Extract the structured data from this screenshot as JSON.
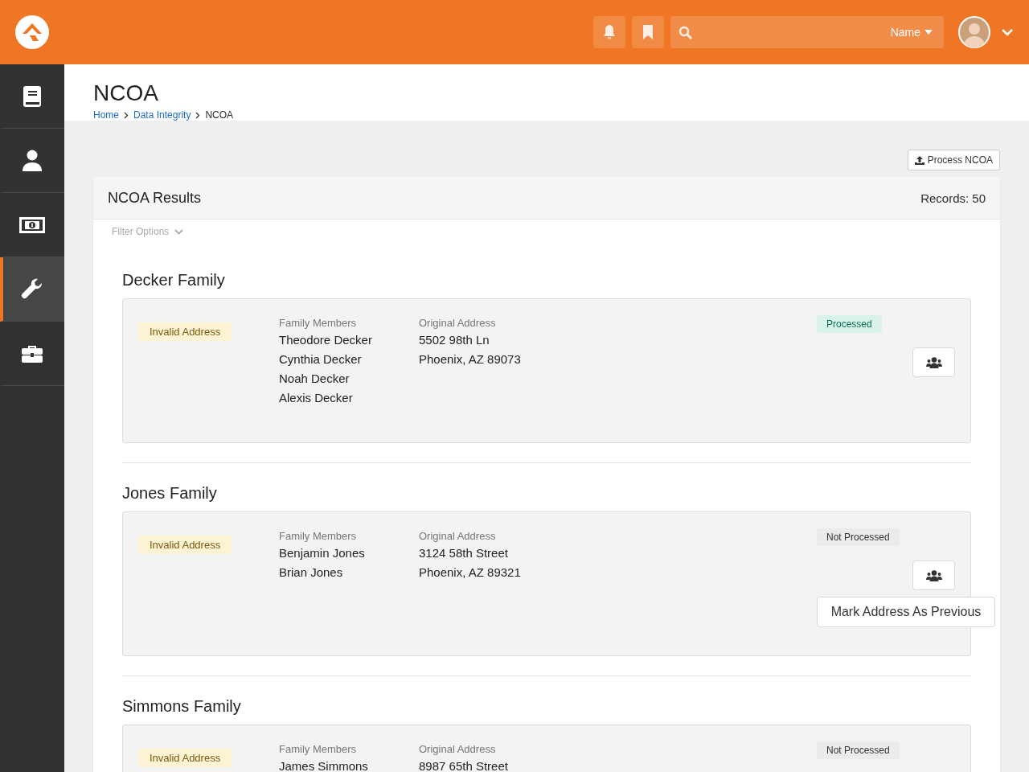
{
  "topbar": {
    "search": {
      "filter_label": "Name"
    }
  },
  "sidebar": {
    "items": [
      {
        "selected": false
      },
      {
        "selected": false
      },
      {
        "selected": false
      },
      {
        "selected": true
      },
      {
        "selected": false
      }
    ]
  },
  "page": {
    "title": "NCOA",
    "breadcrumbs": [
      "Home",
      "Data Integrity",
      "NCOA"
    ]
  },
  "actions": {
    "process_button": "Process NCOA"
  },
  "panel": {
    "title": "NCOA Results",
    "records": "Records: 50",
    "filter": "Filter Options",
    "families": [
      {
        "name": "Decker Family",
        "badge": "Invalid Address",
        "members_label": "Family Members",
        "members": [
          "Theodore Decker",
          "Cynthia Decker",
          "Noah Decker",
          "Alexis Decker"
        ],
        "address_label": "Original Address",
        "address": [
          "5502 98th Ln",
          "Phoenix, AZ 89073"
        ],
        "status": {
          "label": "Processed",
          "processed": true
        }
      },
      {
        "name": "Jones Family",
        "badge": "Invalid Address",
        "members_label": "Family Members",
        "members": [
          "Benjamin Jones",
          "Brian Jones"
        ],
        "address_label": "Original Address",
        "address": [
          "3124 58th Street",
          "Phoenix, AZ 89321"
        ],
        "status": {
          "label": "Not Processed",
          "processed": false
        },
        "action": "Mark Address As Previous"
      },
      {
        "name": "Simmons Family",
        "badge": "Invalid Address",
        "members_label": "Family Members",
        "members": [
          "James Simmons"
        ],
        "address_label": "Original Address",
        "address": [
          "8987 65th Street"
        ],
        "status": {
          "label": "Not Processed",
          "processed": false
        }
      }
    ]
  }
}
